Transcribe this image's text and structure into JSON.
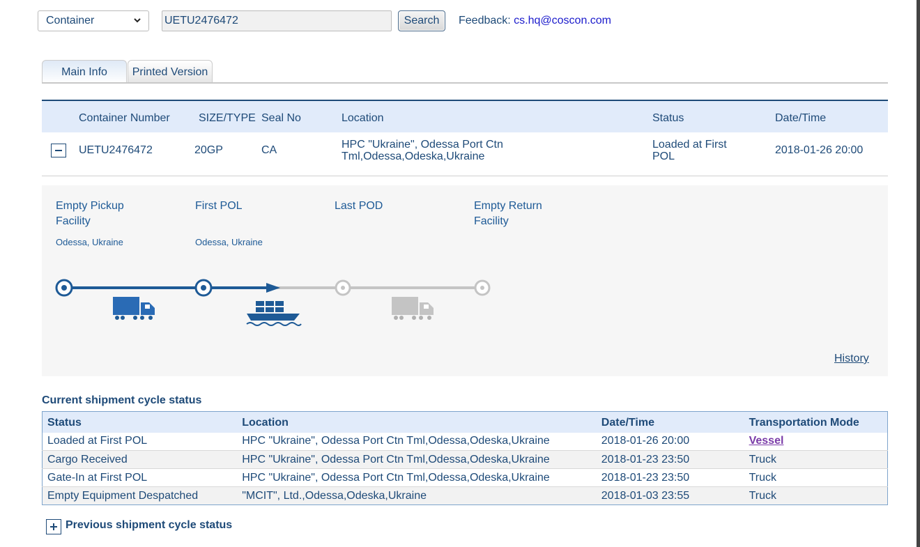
{
  "search": {
    "type_selected": "Container",
    "query_value": "UETU2476472",
    "search_label": "Search",
    "feedback_label": "Feedback: ",
    "feedback_email": "cs.hq@coscon.com"
  },
  "tabs": [
    {
      "label": "Main Info",
      "active": true
    },
    {
      "label": "Printed Version",
      "active": false
    }
  ],
  "container_table": {
    "headers": {
      "number": "Container Number",
      "size_type": "SIZE/TYPE",
      "seal": "Seal No",
      "location": "Location",
      "status": "Status",
      "datetime": "Date/Time"
    },
    "row": {
      "number": "UETU2476472",
      "size_type": "20GP",
      "seal": "CA",
      "location_line1": "HPC \"Ukraine\", Odessa Port Ctn",
      "location_line2": "Tml,Odessa,Odeska,Ukraine",
      "status_line1": "Loaded at First",
      "status_line2": "POL",
      "datetime": "2018-01-26 20:00"
    }
  },
  "progress": {
    "stages": [
      {
        "line1": "Empty Pickup",
        "line2": "Facility",
        "place": "Odessa, Ukraine",
        "reached": true
      },
      {
        "line1": "First POL",
        "line2": "",
        "place": "Odessa, Ukraine",
        "reached": true
      },
      {
        "line1": "Last POD",
        "line2": "",
        "place": "",
        "reached": false
      },
      {
        "line1": "Empty Return",
        "line2": "Facility",
        "place": "",
        "reached": false
      }
    ],
    "legs": [
      {
        "mode": "truck-icon",
        "done": true
      },
      {
        "mode": "ship-icon",
        "done": true
      },
      {
        "mode": "truck-icon",
        "done": false
      }
    ],
    "history_label": "History",
    "colors": {
      "done": "#1e5a96",
      "pending": "#c4c4c4"
    }
  },
  "current_status": {
    "title": "Current shipment cycle status",
    "headers": {
      "status": "Status",
      "location": "Location",
      "datetime": "Date/Time",
      "mode": "Transportation Mode"
    },
    "rows": [
      {
        "status": "Loaded at First POL",
        "location": "HPC \"Ukraine\", Odessa Port Ctn Tml,Odessa,Odeska,Ukraine",
        "datetime": "2018-01-26 20:00",
        "mode": "Vessel"
      },
      {
        "status": "Cargo Received",
        "location": "HPC \"Ukraine\", Odessa Port Ctn Tml,Odessa,Odeska,Ukraine",
        "datetime": "2018-01-23 23:50",
        "mode": "Truck"
      },
      {
        "status": "Gate-In at First POL",
        "location": "HPC \"Ukraine\", Odessa Port Ctn Tml,Odessa,Odeska,Ukraine",
        "datetime": "2018-01-23 23:50",
        "mode": "Truck"
      },
      {
        "status": "Empty Equipment Despatched",
        "location": "\"MCIT\", Ltd.,Odessa,Odeska,Ukraine",
        "datetime": "2018-01-03 23:55",
        "mode": "Truck"
      }
    ]
  },
  "previous_status": {
    "title": "Previous shipment cycle status"
  }
}
